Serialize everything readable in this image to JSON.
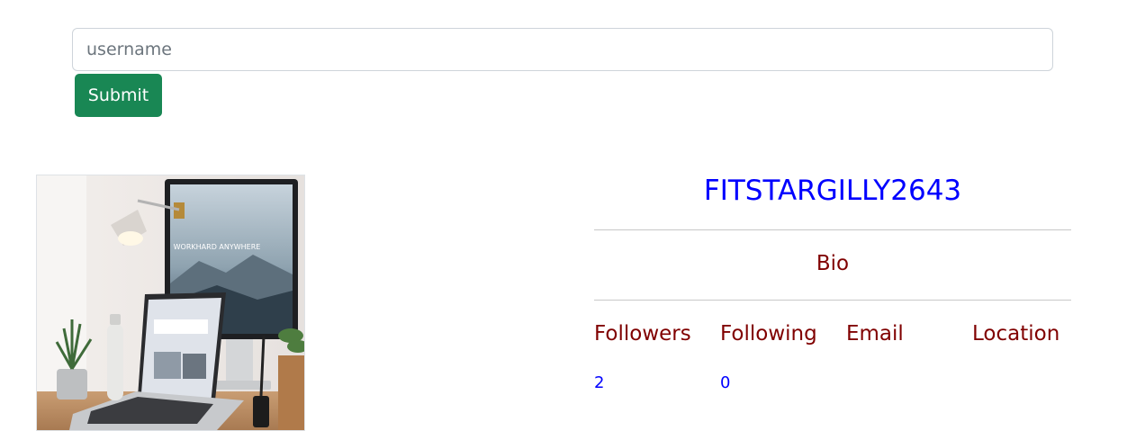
{
  "search": {
    "value": "",
    "placeholder": "username",
    "submit_label": "Submit"
  },
  "profile": {
    "username": "FITSTARGILLY2643",
    "bio": "Bio",
    "stats": {
      "followers_label": "Followers",
      "following_label": "Following",
      "email_label": "Email",
      "location_label": "Location",
      "followers_value": "2",
      "following_value": "0",
      "email_value": "",
      "location_value": ""
    },
    "avatar_caption": "WORKHARD ANYWHERE"
  },
  "colors": {
    "submit_bg": "#198754",
    "username": "#0000ff",
    "labels": "#800000",
    "values": "#0000ff"
  }
}
